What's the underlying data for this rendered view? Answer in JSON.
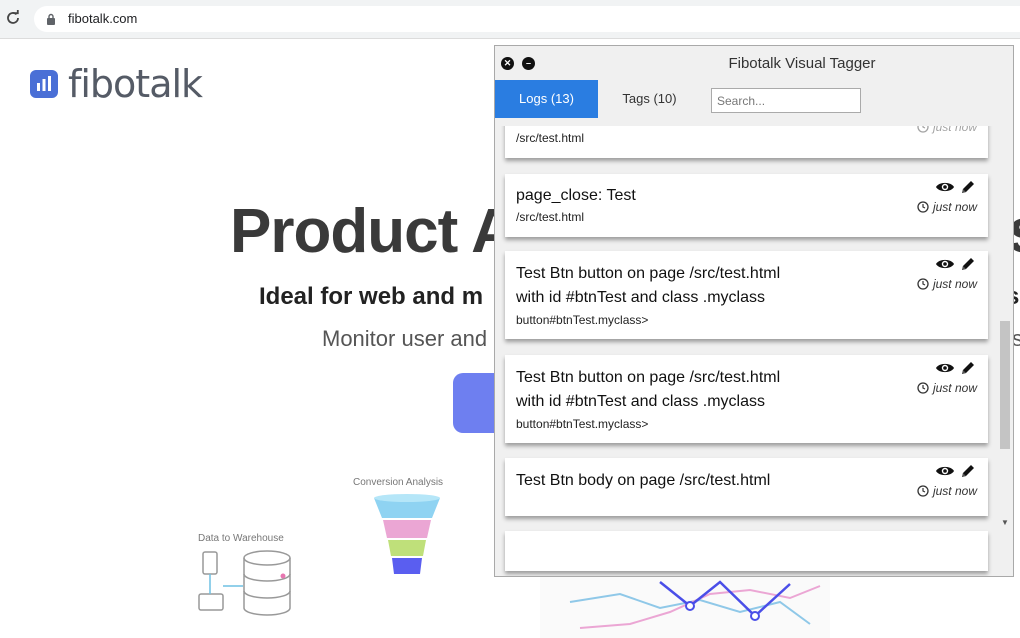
{
  "browser": {
    "url": "fibotalk.com"
  },
  "site": {
    "logo_text": "fibotalk",
    "hero_title": "Product A",
    "hero_title_tail": "s",
    "hero_sub": "Ideal for web and m",
    "hero_sub_tail": "s",
    "hero_desc": "Monitor user and",
    "hero_desc_tail": "s",
    "illus_conversion": "Conversion Analysis",
    "illus_warehouse": "Data to Warehouse"
  },
  "panel": {
    "title": "Fibotalk Visual Tagger",
    "tabs": [
      {
        "label": "Logs (13)",
        "active": true
      },
      {
        "label": "Tags (10)",
        "active": false
      }
    ],
    "search_placeholder": "Search...",
    "partial_card": {
      "path": "/src/test.html",
      "time": "just now"
    },
    "logs": [
      {
        "title_lines": [
          "page_close: Test"
        ],
        "path": "/src/test.html",
        "time": "just now"
      },
      {
        "title_lines": [
          "Test Btn button on page /src/test.html",
          "with id #btnTest and class .myclass"
        ],
        "path": "button#btnTest.myclass>",
        "time": "just now"
      },
      {
        "title_lines": [
          "Test Btn button on page /src/test.html",
          "with id #btnTest and class .myclass"
        ],
        "path": "button#btnTest.myclass>",
        "time": "just now"
      },
      {
        "title_lines": [
          "Test Btn body on page /src/test.html"
        ],
        "path": "",
        "time": "just now"
      }
    ]
  },
  "colors": {
    "active_tab": "#2a7de1",
    "logo_blue": "#4a6fd6",
    "cta_purple": "#6e7ff0"
  },
  "icons": [
    "reload-icon",
    "lock-icon",
    "close-icon",
    "minimize-icon",
    "eye-icon",
    "pencil-icon",
    "clock-icon"
  ]
}
